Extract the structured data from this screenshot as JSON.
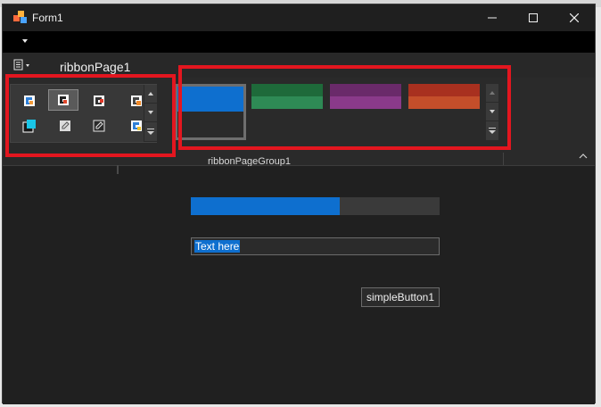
{
  "window": {
    "title": "Form1"
  },
  "ribbon": {
    "page_tab": "ribbonPage1",
    "group_label": "ribbonPageGroup1",
    "icon_gallery": {
      "items": [
        {
          "name": "app-icon-blue",
          "selected": false
        },
        {
          "name": "app-icon-dark",
          "selected": true
        },
        {
          "name": "app-icon-white-red",
          "selected": false
        },
        {
          "name": "app-icon-orange",
          "selected": false
        },
        {
          "name": "cyan-window-icon",
          "selected": false
        },
        {
          "name": "edit-doc-icon",
          "selected": false
        },
        {
          "name": "edit-doc-dark-icon",
          "selected": false
        },
        {
          "name": "app-icon-yellow",
          "selected": false
        }
      ]
    },
    "skin_gallery": {
      "items": [
        {
          "name": "Blue",
          "colors": [
            "#0e6fcf",
            "#0e6fcf",
            "#2a2a2a"
          ],
          "selected": true
        },
        {
          "name": "Green",
          "colors": [
            "#1e6a3a",
            "#2e8a55",
            "#2a2a2a"
          ],
          "selected": false
        },
        {
          "name": "Purple",
          "colors": [
            "#6a2a6a",
            "#8a3a8a",
            "#2a2a2a"
          ],
          "selected": false
        },
        {
          "name": "Orange",
          "colors": [
            "#a8301f",
            "#c44e2a",
            "#2a2a2a"
          ],
          "selected": false
        }
      ]
    }
  },
  "content": {
    "progress_fraction": 0.6,
    "textbox_value": "Text here",
    "button_label": "simpleButton1"
  },
  "colors": {
    "accent": "#0e6fcf",
    "highlight_box": "#e3161f"
  }
}
